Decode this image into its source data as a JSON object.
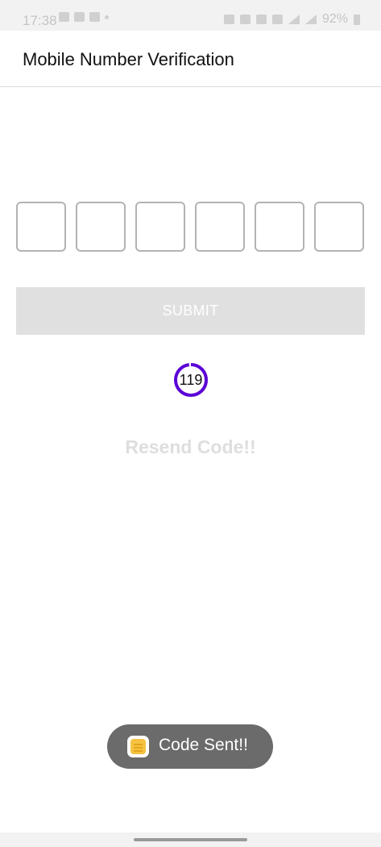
{
  "status_bar": {
    "time": "17:38",
    "battery": "92%",
    "left_icons": [
      "usb-icon",
      "gallery-icon",
      "mail-icon",
      "dot-icon"
    ],
    "right_icons": [
      "alarm-icon",
      "mute-icon",
      "data-icon",
      "wifi-icon",
      "signal-icon",
      "signal-icon",
      "battery-icon"
    ]
  },
  "app_bar": {
    "title": "Mobile Number Verification"
  },
  "otp": {
    "digits": [
      "",
      "",
      "",
      "",
      "",
      ""
    ]
  },
  "submit": {
    "label": "SUBMIT"
  },
  "timer": {
    "value": "119",
    "color": "#5b00d6"
  },
  "resend": {
    "label": "Resend Code!!"
  },
  "toast": {
    "message": "Code Sent!!",
    "icon": "notes-app-icon"
  },
  "colors": {
    "submit_bg": "#e0e0e0",
    "resend_text": "#dedede",
    "toast_bg": "#6b6b6b",
    "otp_border": "#b3b3b3"
  }
}
